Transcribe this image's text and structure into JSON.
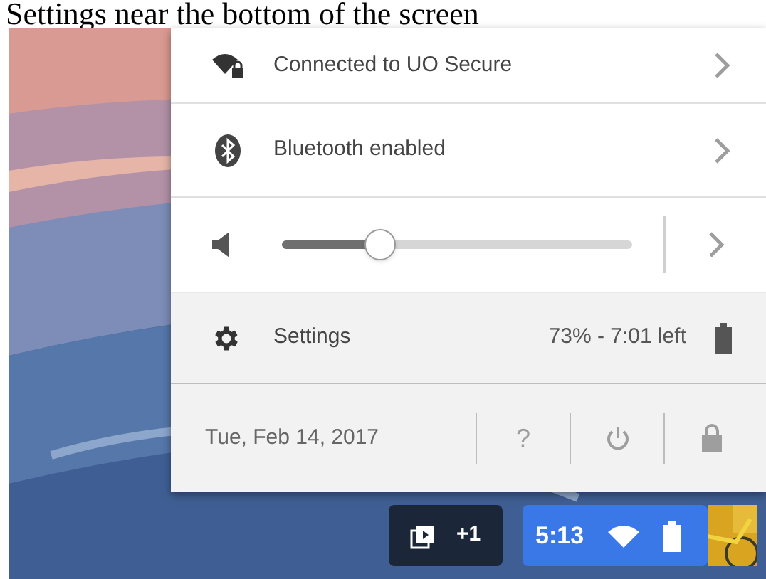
{
  "caption": "Settings near the bottom of the screen",
  "menu": {
    "rows": [
      {
        "kind": "network",
        "label": "Connected to UO Secure"
      },
      {
        "kind": "bluetooth",
        "label": "Bluetooth enabled"
      }
    ],
    "volume": {
      "level": 0.28
    },
    "settings": {
      "label": "Settings",
      "battery": "73% - 7:01 left"
    },
    "footer": {
      "date": "Tue, Feb 14, 2017",
      "buttons": [
        {
          "kind": "help",
          "label": "?"
        },
        {
          "kind": "power"
        },
        {
          "kind": "lock"
        }
      ]
    }
  },
  "shelf": {
    "notifications": "+1",
    "time": "5:13"
  }
}
